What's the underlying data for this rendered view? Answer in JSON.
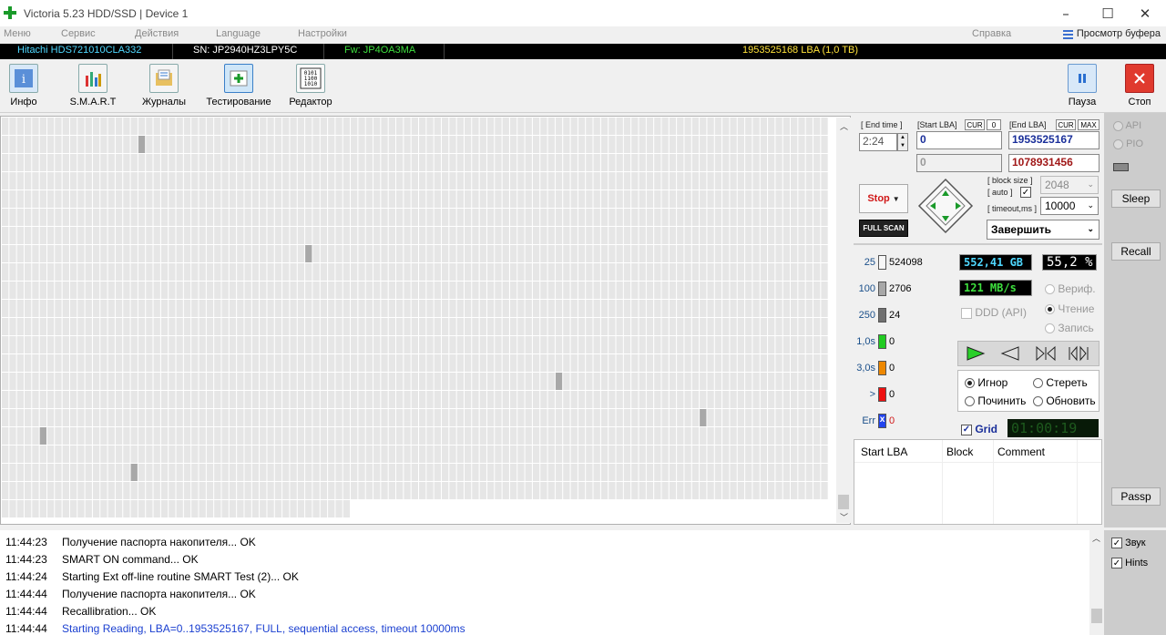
{
  "window": {
    "title": "Victoria 5.23 HDD/SSD | Device 1",
    "min": "–",
    "max": "☐",
    "close": "✕"
  },
  "menu": {
    "items": [
      "Меню",
      "Сервис",
      "Действия",
      "Language",
      "Настройки"
    ],
    "help": "Справка",
    "buffer_view": "Просмотр буфера"
  },
  "device": {
    "model": "Hitachi HDS721010CLA332",
    "serial": "SN: JP2940HZ3LPY5C",
    "firmware": "Fw: JP4OA3MA",
    "lba": "1953525168 LBA (1,0 TB)"
  },
  "toolbar": {
    "info": "Инфо",
    "smart": "S.M.A.R.T",
    "logs": "Журналы",
    "testing": "Тестирование",
    "editor": "Редактор",
    "pause": "Пауза",
    "stop": "Стоп"
  },
  "scan": {
    "grid_cols": 110,
    "rows": 21,
    "filled_last_row": 46,
    "marks": [
      {
        "r": 1,
        "c": 18
      },
      {
        "r": 7,
        "c": 40
      },
      {
        "r": 14,
        "c": 73
      },
      {
        "r": 16,
        "c": 92
      },
      {
        "r": 17,
        "c": 5
      },
      {
        "r": 19,
        "c": 17
      }
    ]
  },
  "controls": {
    "end_time_label": "[ End time ]",
    "end_time": "2:24",
    "start_lba_label": "[Start LBA]",
    "cur": "CUR",
    "zero": "0",
    "start_lba": "0",
    "start_lba2": "0",
    "end_lba_label": "[End LBA]",
    "max": "MAX",
    "end_lba": "1953525167",
    "end_lba2": "1078931456",
    "stop_btn": "Stop",
    "full_scan": "FULL SCAN",
    "block_size_label": "[ block size ]",
    "auto_label": "[ auto ]",
    "block_size": "2048",
    "timeout_label": "[ timeout,ms ]",
    "timeout": "10000",
    "finish": "Завершить"
  },
  "stats": [
    {
      "label": "25",
      "count": "524098",
      "color": "#f8f8f8"
    },
    {
      "label": "100",
      "count": "2706",
      "color": "#a8a8a8"
    },
    {
      "label": "250",
      "count": "24",
      "color": "#707070"
    },
    {
      "label": "1,0s",
      "count": "0",
      "color": "#22cc22"
    },
    {
      "label": "3,0s",
      "count": "0",
      "color": "#ee8800"
    },
    {
      "label": ">",
      "count": "0",
      "color": "#ee1111"
    },
    {
      "label": "Err",
      "count": "0",
      "color": "#2244ee"
    }
  ],
  "progress": {
    "gb": "552,41 GB",
    "percent": "55,2",
    "pct_sign": "%",
    "speed": "121 MB/s"
  },
  "modes": {
    "verify": "Вериф.",
    "read": "Чтение",
    "write": "Запись",
    "ddd": "DDD (API)"
  },
  "actions": {
    "ignore": "Игнор",
    "erase": "Стереть",
    "repair": "Починить",
    "refresh": "Обновить"
  },
  "grid_label": "Grid",
  "timer": "01:00:19",
  "table": {
    "col1": "Start LBA",
    "col2": "Block",
    "col3": "Comment"
  },
  "side": {
    "api": "API",
    "pio": "PIO",
    "sleep": "Sleep",
    "recall": "Recall",
    "passp": "Passp",
    "sound": "Звук",
    "hints": "Hints"
  },
  "log": [
    {
      "time": "11:44:23",
      "msg": "Получение паспорта накопителя... OK",
      "color": "#000"
    },
    {
      "time": "11:44:23",
      "msg": "SMART ON command... OK",
      "color": "#000"
    },
    {
      "time": "11:44:24",
      "msg": "Starting Ext off-line routine SMART Test (2)... OK",
      "color": "#000"
    },
    {
      "time": "11:44:44",
      "msg": "Получение паспорта накопителя... OK",
      "color": "#000"
    },
    {
      "time": "11:44:44",
      "msg": "Recallibration... OK",
      "color": "#000"
    },
    {
      "time": "11:44:44",
      "msg": "Starting Reading, LBA=0..1953525167, FULL, sequential access, timeout 10000ms",
      "color": "#1a3fd0"
    }
  ]
}
